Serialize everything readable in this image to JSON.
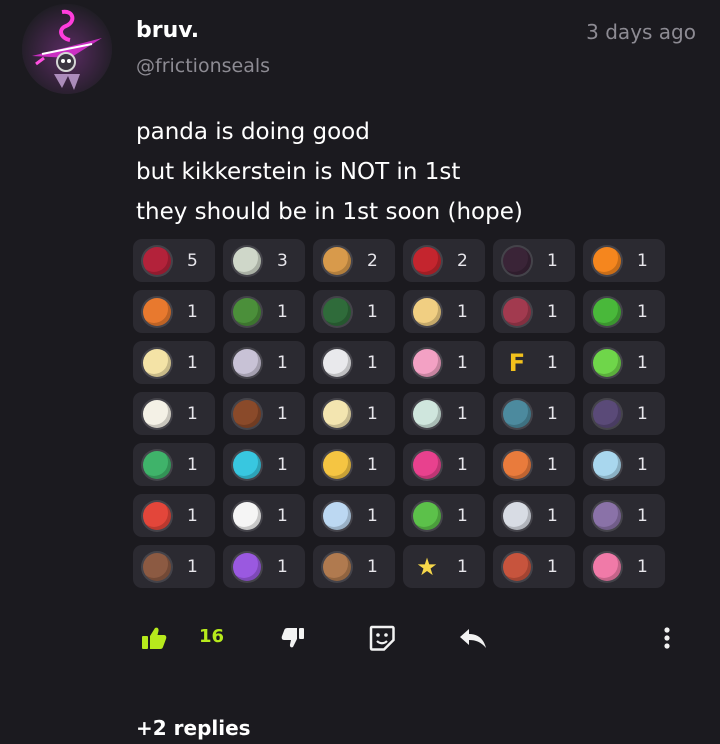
{
  "comment": {
    "username": "bruv.",
    "handle": "@frictionseals",
    "timestamp": "3 days ago",
    "lines": [
      "panda is doing good",
      "but kikkerstein is NOT in 1st",
      "they should be in 1st soon (hope)"
    ]
  },
  "reactions": [
    {
      "icon": "red-creature-icon",
      "count": "5",
      "color": "#b3223a"
    },
    {
      "icon": "turnip-icon",
      "count": "3",
      "color": "#cfd7c9"
    },
    {
      "icon": "cookie-icon",
      "count": "2",
      "color": "#d89a4b"
    },
    {
      "icon": "red-hood-icon",
      "count": "2",
      "color": "#c4252e"
    },
    {
      "icon": "dark-creature-icon",
      "count": "1",
      "color": "#3a2437"
    },
    {
      "icon": "fire-icon",
      "count": "1",
      "color": "#f5861e"
    },
    {
      "icon": "fox-icon",
      "count": "1",
      "color": "#e8792e"
    },
    {
      "icon": "creeper-icon",
      "count": "1",
      "color": "#4b8f3a"
    },
    {
      "icon": "crewmate-icon",
      "count": "1",
      "color": "#2f6b3a"
    },
    {
      "icon": "cracker-heart-icon",
      "count": "1",
      "color": "#f1cf82"
    },
    {
      "icon": "spiky-character-icon",
      "count": "1",
      "color": "#a23a4f"
    },
    {
      "icon": "frog-tongue-icon",
      "count": "1",
      "color": "#49b83a"
    },
    {
      "icon": "chick-icon",
      "count": "1",
      "color": "#f4e3a6"
    },
    {
      "icon": "ghost-skull-icon",
      "count": "1",
      "color": "#c8c2d6"
    },
    {
      "icon": "bow-tie-icon",
      "count": "1",
      "color": "#e9e9ec"
    },
    {
      "icon": "pink-bow-icon",
      "count": "1",
      "color": "#f3a1c4"
    },
    {
      "icon": "letter-f-icon",
      "count": "1",
      "color": "#f2c11c",
      "glyph": "F"
    },
    {
      "icon": "green-potion-icon",
      "count": "1",
      "color": "#6fd64a"
    },
    {
      "icon": "king-doodle-icon",
      "count": "1",
      "color": "#f4f1e6"
    },
    {
      "icon": "bob-ross-icon",
      "count": "1",
      "color": "#8a4a2a"
    },
    {
      "icon": "duck-egg-icon",
      "count": "1",
      "color": "#f3e5b0"
    },
    {
      "icon": "face-mask-icon",
      "count": "1",
      "color": "#cfe6dd"
    },
    {
      "icon": "duck-icon",
      "count": "1",
      "color": "#4c8a9e"
    },
    {
      "icon": "top-hat-icon",
      "count": "1",
      "color": "#5a4a78"
    },
    {
      "icon": "green-slime-icon",
      "count": "1",
      "color": "#3fb36a"
    },
    {
      "icon": "tube-man-icon",
      "count": "1",
      "color": "#38c7e0"
    },
    {
      "icon": "laughing-face-icon",
      "count": "1",
      "color": "#f5c542"
    },
    {
      "icon": "punch-icon",
      "count": "1",
      "color": "#e8418e"
    },
    {
      "icon": "angry-cat-icon",
      "count": "1",
      "color": "#e97b3c"
    },
    {
      "icon": "tiara-icon",
      "count": "1",
      "color": "#a9d7ee"
    },
    {
      "icon": "spray-bottle-icon",
      "count": "1",
      "color": "#e3463a"
    },
    {
      "icon": "sunglasses-icon",
      "count": "1",
      "color": "#f5f5f5"
    },
    {
      "icon": "blob-ghost-icon",
      "count": "1",
      "color": "#bcd8f2"
    },
    {
      "icon": "frog-hearts-icon",
      "count": "1",
      "color": "#5cc14a"
    },
    {
      "icon": "microphone-icon",
      "count": "1",
      "color": "#d8dce4"
    },
    {
      "icon": "grim-reaper-icon",
      "count": "1",
      "color": "#8a72a8"
    },
    {
      "icon": "iced-coffee-icon",
      "count": "1",
      "color": "#8c5a42"
    },
    {
      "icon": "purple-hand-icon",
      "count": "1",
      "color": "#9a59e0"
    },
    {
      "icon": "dancing-guy-icon",
      "count": "1",
      "color": "#b07a4f"
    },
    {
      "icon": "star-icon",
      "count": "1",
      "color": "#f6d74a",
      "glyph": "★"
    },
    {
      "icon": "cat-face-icon",
      "count": "1",
      "color": "#c7543d"
    },
    {
      "icon": "lips-icon",
      "count": "1",
      "color": "#f07aa8"
    }
  ],
  "actions": {
    "like_count": "16",
    "accent": "#b7ea1c"
  },
  "replies_label": "+2 replies"
}
